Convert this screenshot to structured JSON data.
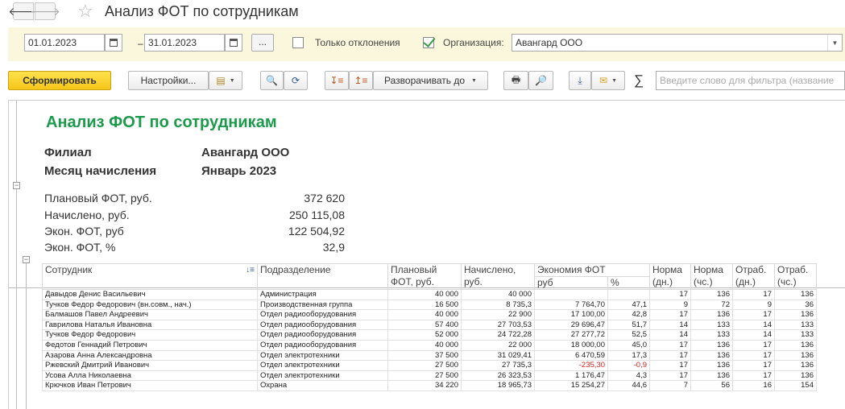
{
  "window": {
    "title": "Анализ ФОТ по сотрудникам"
  },
  "filters": {
    "date_from": "01.01.2023",
    "date_separator": "–",
    "date_to": "31.01.2023",
    "period_button": "...",
    "only_deviations_label": "Только отклонения",
    "only_deviations_checked": false,
    "organization_checked": true,
    "organization_label": "Организация:",
    "organization_value": "Авангард ООО"
  },
  "toolbar": {
    "generate_label": "Сформировать",
    "settings_label": "Настройки...",
    "expand_label": "Разворачивать до",
    "sum_symbol": "∑",
    "search_placeholder": "Введите слово для фильтра (название"
  },
  "report": {
    "title": "Анализ ФОТ по сотрудникам",
    "branch_label": "Филиал",
    "branch_value": "Авангард ООО",
    "month_label": "Месяц начисления",
    "month_value": "Январь 2023",
    "summary": [
      {
        "label": "Плановый ФОТ, руб.",
        "value": "372 620"
      },
      {
        "label": "Начислено, руб.",
        "value": "250 115,08"
      },
      {
        "label": "Экон. ФОТ, руб",
        "value": "122 504,92"
      },
      {
        "label": "Экон. ФОТ, %",
        "value": "32,9"
      }
    ],
    "columns": {
      "employee": "Сотрудник",
      "department": "Подразделение",
      "plan": "Плановый ФОТ, руб.",
      "accrued": "Начислено, руб.",
      "economy": "Экономия ФОТ",
      "economy_rub": "руб",
      "economy_pct": "%",
      "norm_days": "Норма (дн.)",
      "norm_hours": "Норма (чс.)",
      "worked_days": "Отраб. (дн.)",
      "worked_hours": "Отраб. (чс.)"
    },
    "rows": [
      {
        "employee": "Давыдов Денис Васильевич",
        "department": "Администрация",
        "plan": "40 000",
        "accrued": "40 000",
        "econ_rub": "",
        "econ_pct": "",
        "norm_d": "17",
        "norm_h": "136",
        "work_d": "17",
        "work_h": "136",
        "negative": false
      },
      {
        "employee": "Тучков Федор Федорович (вн.совм., нач.)",
        "department": "Производственная группа",
        "plan": "16 500",
        "accrued": "8 735,3",
        "econ_rub": "7 764,70",
        "econ_pct": "47,1",
        "norm_d": "9",
        "norm_h": "72",
        "work_d": "9",
        "work_h": "36",
        "negative": false
      },
      {
        "employee": "Балмашов Павел Андреевич",
        "department": "Отдел радиооборудования",
        "plan": "40 000",
        "accrued": "22 900",
        "econ_rub": "17 100,00",
        "econ_pct": "42,8",
        "norm_d": "17",
        "norm_h": "136",
        "work_d": "17",
        "work_h": "136",
        "negative": false
      },
      {
        "employee": "Гаврилова Наталья Ивановна",
        "department": "Отдел радиооборудования",
        "plan": "57 400",
        "accrued": "27 703,53",
        "econ_rub": "29 696,47",
        "econ_pct": "51,7",
        "norm_d": "14",
        "norm_h": "133",
        "work_d": "14",
        "work_h": "133",
        "negative": false
      },
      {
        "employee": "Тучков Федор Федорович",
        "department": "Отдел радиооборудования",
        "plan": "52 000",
        "accrued": "24 722,28",
        "econ_rub": "27 277,72",
        "econ_pct": "52,5",
        "norm_d": "14",
        "norm_h": "133",
        "work_d": "14",
        "work_h": "133",
        "negative": false
      },
      {
        "employee": "Федотов Геннадий Петрович",
        "department": "Отдел радиооборудования",
        "plan": "40 000",
        "accrued": "22 000",
        "econ_rub": "18 000,00",
        "econ_pct": "45,0",
        "norm_d": "17",
        "norm_h": "136",
        "work_d": "17",
        "work_h": "136",
        "negative": false
      },
      {
        "employee": "Азарова Анна Александровна",
        "department": "Отдел электротехники",
        "plan": "37 500",
        "accrued": "31 029,41",
        "econ_rub": "6 470,59",
        "econ_pct": "17,3",
        "norm_d": "17",
        "norm_h": "136",
        "work_d": "17",
        "work_h": "136",
        "negative": false
      },
      {
        "employee": "Ржевский Дмитрий Иванович",
        "department": "Отдел электротехники",
        "plan": "27 500",
        "accrued": "27 735,3",
        "econ_rub": "-235,30",
        "econ_pct": "-0,9",
        "norm_d": "17",
        "norm_h": "136",
        "work_d": "17",
        "work_h": "136",
        "negative": true
      },
      {
        "employee": "Усова Алла Николаевна",
        "department": "Отдел электротехники",
        "plan": "27 500",
        "accrued": "26 323,53",
        "econ_rub": "1 176,47",
        "econ_pct": "4,3",
        "norm_d": "17",
        "norm_h": "136",
        "work_d": "17",
        "work_h": "136",
        "negative": false
      },
      {
        "employee": "Крючков Иван Петрович",
        "department": "Охрана",
        "plan": "34 220",
        "accrued": "18 965,73",
        "econ_rub": "15 254,27",
        "econ_pct": "44,6",
        "norm_d": "7",
        "norm_h": "56",
        "work_d": "16",
        "work_h": "154",
        "negative": false
      }
    ]
  },
  "colors": {
    "accent_green": "#1a9a4a",
    "filter_background": "#fbf7dc",
    "primary_button": "#f5c518",
    "negative": "#e02020"
  }
}
